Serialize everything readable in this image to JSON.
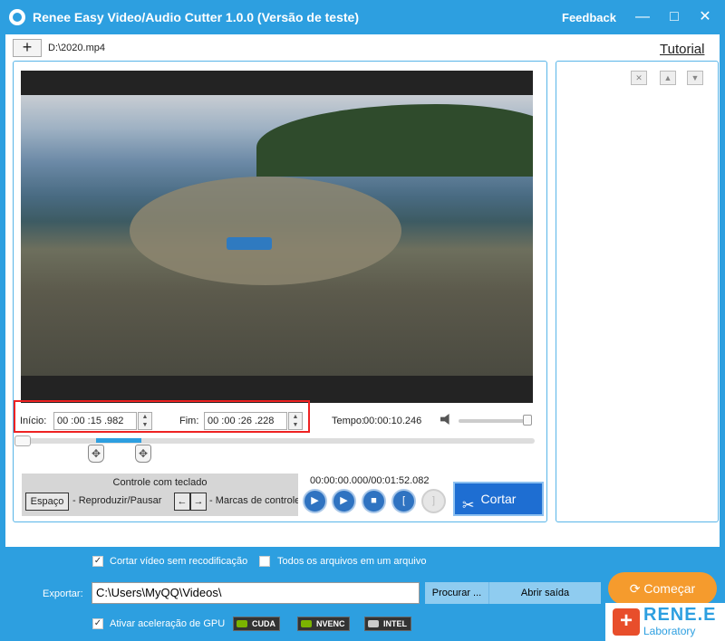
{
  "window": {
    "title": "Renee Easy Video/Audio Cutter 1.0.0 (Versão de teste)",
    "feedback": "Feedback",
    "minimize_glyph": "—",
    "maximize_glyph": "□",
    "close_glyph": "✕"
  },
  "toolbar": {
    "add_glyph": "+",
    "file_path": "D:\\2020.mp4",
    "tutorial": "Tutorial"
  },
  "right_panel": {
    "delete_glyph": "✕",
    "up_glyph": "▲",
    "down_glyph": "▼"
  },
  "timing": {
    "start_label": "Início:",
    "start_value": "00 :00 :15 .982",
    "end_label": "Fim:",
    "end_value": "00 :00 :26 .228",
    "duration_label": "Tempo:",
    "duration_value": "00:00:10.246",
    "spin_up": "▲",
    "spin_down": "▼"
  },
  "volume": {
    "level": 1.0
  },
  "seek": {
    "position": 0.0
  },
  "markers": {
    "glyph": "✥"
  },
  "keyboard": {
    "title": "Controle com teclado",
    "space_key": "Espaço",
    "space_desc": "- Reproduzir/Pausar",
    "arrow_left": "←",
    "arrow_right": "→",
    "arrow_desc": "- Marcas de controle"
  },
  "player": {
    "timecode": "00:00:00.000/00:01:52.082",
    "play_glyph": "▶",
    "play_sel_glyph": "▶",
    "stop_glyph": "■",
    "mark_start_glyph": "[",
    "mark_end_glyph": "]"
  },
  "cut_button": {
    "label": "Cortar",
    "icon": "✂"
  },
  "options": {
    "no_reencode_label": "Cortar vídeo sem recodificação",
    "no_reencode_checked": true,
    "merge_label": "Todos os arquivos em um arquivo",
    "merge_checked": false,
    "gpu_label": "Ativar aceleração de GPU",
    "gpu_checked": true,
    "check_glyph": "✓"
  },
  "export": {
    "label": "Exportar:",
    "path": "C:\\Users\\MyQQ\\Videos\\",
    "browse": "Procurar ...",
    "open": "Abrir saída"
  },
  "gpu_badges": [
    "CUDA",
    "NVENC",
    "INTEL"
  ],
  "start_button": {
    "label": "Começar",
    "icon": "⟳"
  },
  "logo": {
    "cross": "+",
    "text": "RENE.E",
    "sub": "Laboratory"
  }
}
